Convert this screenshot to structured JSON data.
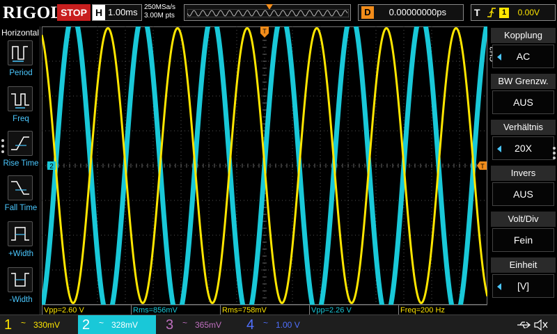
{
  "brand": "RIGOL",
  "run_state": "STOP",
  "timebase": {
    "letter": "H",
    "value": "1.00ms"
  },
  "sample_rate": "250MSa/s",
  "memory_depth": "3.00M pts",
  "delay": {
    "letter": "D",
    "value": "0.00000000ps"
  },
  "trigger": {
    "letter": "T",
    "source": "1",
    "level": "0.00V"
  },
  "left_menu": {
    "title": "Horizontal",
    "items": [
      {
        "label": "Period",
        "icon": "period-icon"
      },
      {
        "label": "Freq",
        "icon": "freq-icon"
      },
      {
        "label": "Rise Time",
        "icon": "rise-time-icon"
      },
      {
        "label": "Fall Time",
        "icon": "fall-time-icon"
      },
      {
        "label": "+Width",
        "icon": "pos-width-icon"
      },
      {
        "label": "-Width",
        "icon": "neg-width-icon"
      }
    ]
  },
  "right_menu": {
    "channel_tag": "CH2",
    "options": [
      {
        "title": "Kopplung",
        "value": "AC",
        "arrow": true
      },
      {
        "title": "BW Grenzw.",
        "value": "AUS",
        "arrow": false
      },
      {
        "title": "Verhältnis",
        "value": "20X",
        "arrow": true
      },
      {
        "title": "Invers",
        "value": "AUS",
        "arrow": false
      },
      {
        "title": "Volt/Div",
        "value": "Fein",
        "arrow": false
      },
      {
        "title": "Einheit",
        "value": "[V]",
        "arrow": true
      }
    ]
  },
  "markers": {
    "ch2_ground": "2",
    "trigger_level": "T",
    "trigger_pos": "T"
  },
  "measurements": [
    {
      "text": "Vpp=2.60 V",
      "color": "#ffe600"
    },
    {
      "text": "Rms=856mV",
      "color": "#19c8d8"
    },
    {
      "text": "Rms=758mV",
      "color": "#ffe600"
    },
    {
      "text": "Vpp=2.26 V",
      "color": "#19c8d8"
    },
    {
      "text": "Freq=200 Hz",
      "color": "#ffe600"
    }
  ],
  "channels": [
    {
      "num": "1",
      "coupling": "~",
      "scale": "330mV",
      "color": "#ffe600"
    },
    {
      "num": "2",
      "coupling": "~",
      "scale": "328mV",
      "color": "#19c8d8"
    },
    {
      "num": "3",
      "coupling": "~",
      "scale": "365mV",
      "color": "#c070c0"
    },
    {
      "num": "4",
      "coupling": "~",
      "scale": "1.00 V",
      "color": "#5070ff"
    }
  ],
  "colors": {
    "ch1": "#ffe600",
    "ch2": "#19c8d8",
    "trigger": "#f28c1a",
    "accent": "#4bc8ff",
    "stop": "#c81e1e"
  },
  "waveforms": {
    "ch1": {
      "amplitude_div": 3.95,
      "period_div": 2.5,
      "phase": "inverted-sine"
    },
    "ch2": {
      "amplitude_div": 4.35,
      "period_div": 2.5,
      "phase": "sine"
    }
  }
}
